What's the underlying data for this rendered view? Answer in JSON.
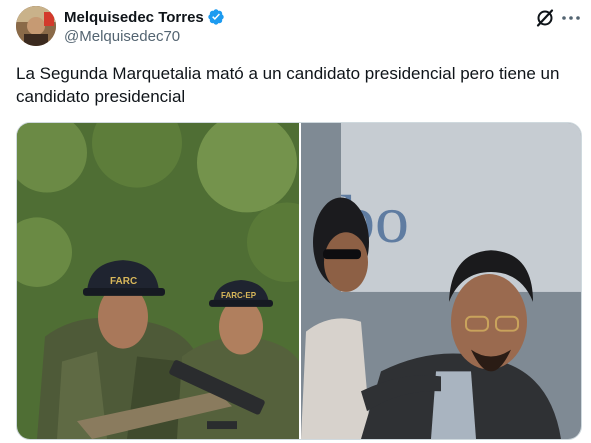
{
  "author": {
    "display_name": "Melquisedec Torres",
    "handle": "@Melquisedec70",
    "verified": true
  },
  "tweet": {
    "text": "La Segunda Marquetalia mató a un candidato presidencial pero tiene un candidato presidencial"
  },
  "media": {
    "left_cap_1": "FARC",
    "left_cap_2": "FARC-EP",
    "right_sign": "bo"
  },
  "icons": {
    "grok": "grok-slash-icon",
    "more": "more-dots-icon",
    "verified": "verified-badge-icon"
  },
  "colors": {
    "verified_blue": "#1d9bf0",
    "text_primary": "#0f1419",
    "text_secondary": "#536471"
  }
}
